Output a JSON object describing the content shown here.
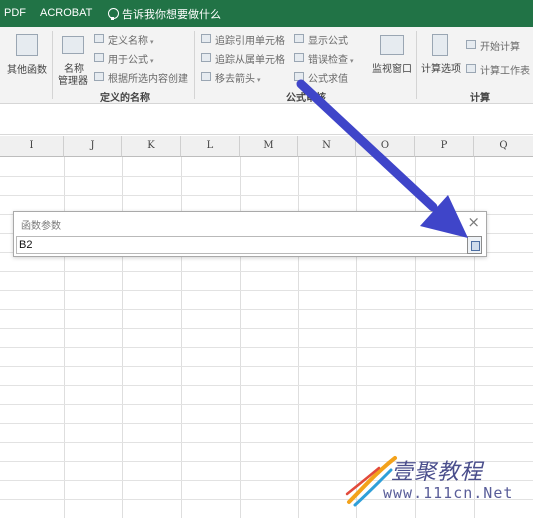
{
  "tabs": [
    "PDF",
    "ACROBAT"
  ],
  "tell_me": "告诉我你想要做什么",
  "ribbon": {
    "more_functions": "其他函数",
    "name_manager": [
      "名称",
      "管理器"
    ],
    "define_name": "定义名称",
    "use_in_formula": "用于公式",
    "create_from_selection": "根据所选内容创建",
    "defined_names_group": "定义的名称",
    "trace_precedents": "追踪引用单元格",
    "trace_dependents": "追踪从属单元格",
    "remove_arrows": "移去箭头",
    "show_formulas": "显示公式",
    "error_checking": "错误检查",
    "evaluate_formula": "公式求值",
    "watch_window": "监视窗口",
    "formula_auditing_group": "公式审核",
    "calculation_options": "计算选项",
    "calculate_now": "开始计算",
    "calculate_sheet": "计算工作表",
    "calculation_group": "计算"
  },
  "columns": [
    "I",
    "J",
    "K",
    "L",
    "M",
    "N",
    "O",
    "P",
    "Q"
  ],
  "dialog": {
    "title": "函数参数",
    "close": "×",
    "value": "B2"
  },
  "watermark": {
    "brand": "壹聚教程",
    "url": "www.111cn.Net"
  },
  "colors": {
    "tab_green": "#217346",
    "arrow_blue": "#3f45c9"
  }
}
